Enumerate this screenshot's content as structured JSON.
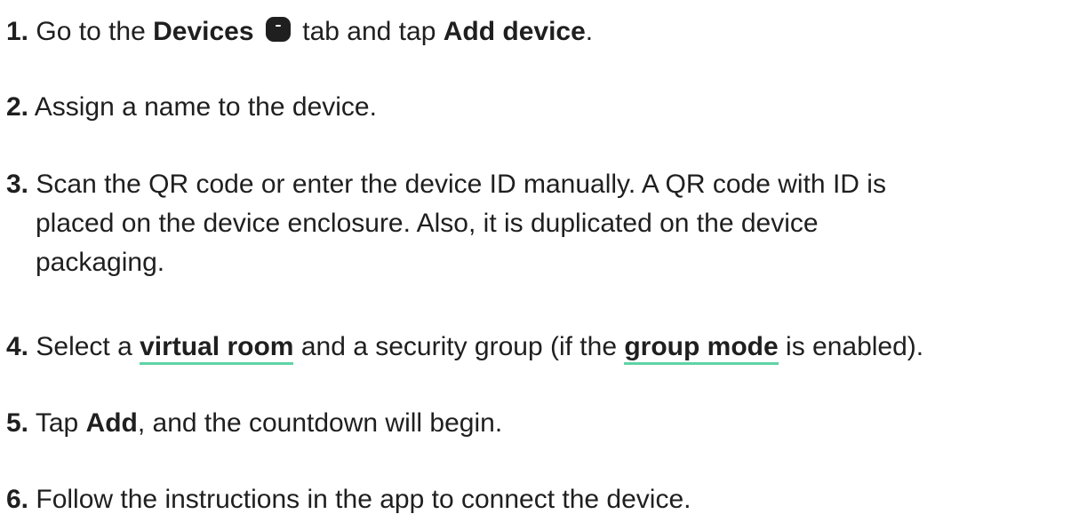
{
  "steps": [
    {
      "number": "1.",
      "t1": "Go to the ",
      "b1": "Devices",
      "t2": " tab and tap ",
      "b2": "Add device",
      "t3": ".",
      "icon": "devices-tab-icon"
    },
    {
      "number": "2.",
      "t1": "Assign a name to the device."
    },
    {
      "number": "3.",
      "line1": "Scan the QR code or enter the device ID manually. A QR code with ID is",
      "line2": "placed on the device enclosure. Also, it is duplicated on the device",
      "line3": "packaging."
    },
    {
      "number": "4.",
      "t1": "Select a ",
      "link1": "virtual room",
      "t2": " and a security group (if the ",
      "link2": "group mode",
      "t3": " is enabled)."
    },
    {
      "number": "5.",
      "t1": "Tap ",
      "b1": "Add",
      "t2": ", and the countdown will begin."
    },
    {
      "number": "6.",
      "t1": "Follow the instructions in the app to connect the device."
    }
  ],
  "colors": {
    "text": "#1f1f1f",
    "link_underline": "#5fd4a6",
    "icon_fill": "#1f1f1f"
  }
}
